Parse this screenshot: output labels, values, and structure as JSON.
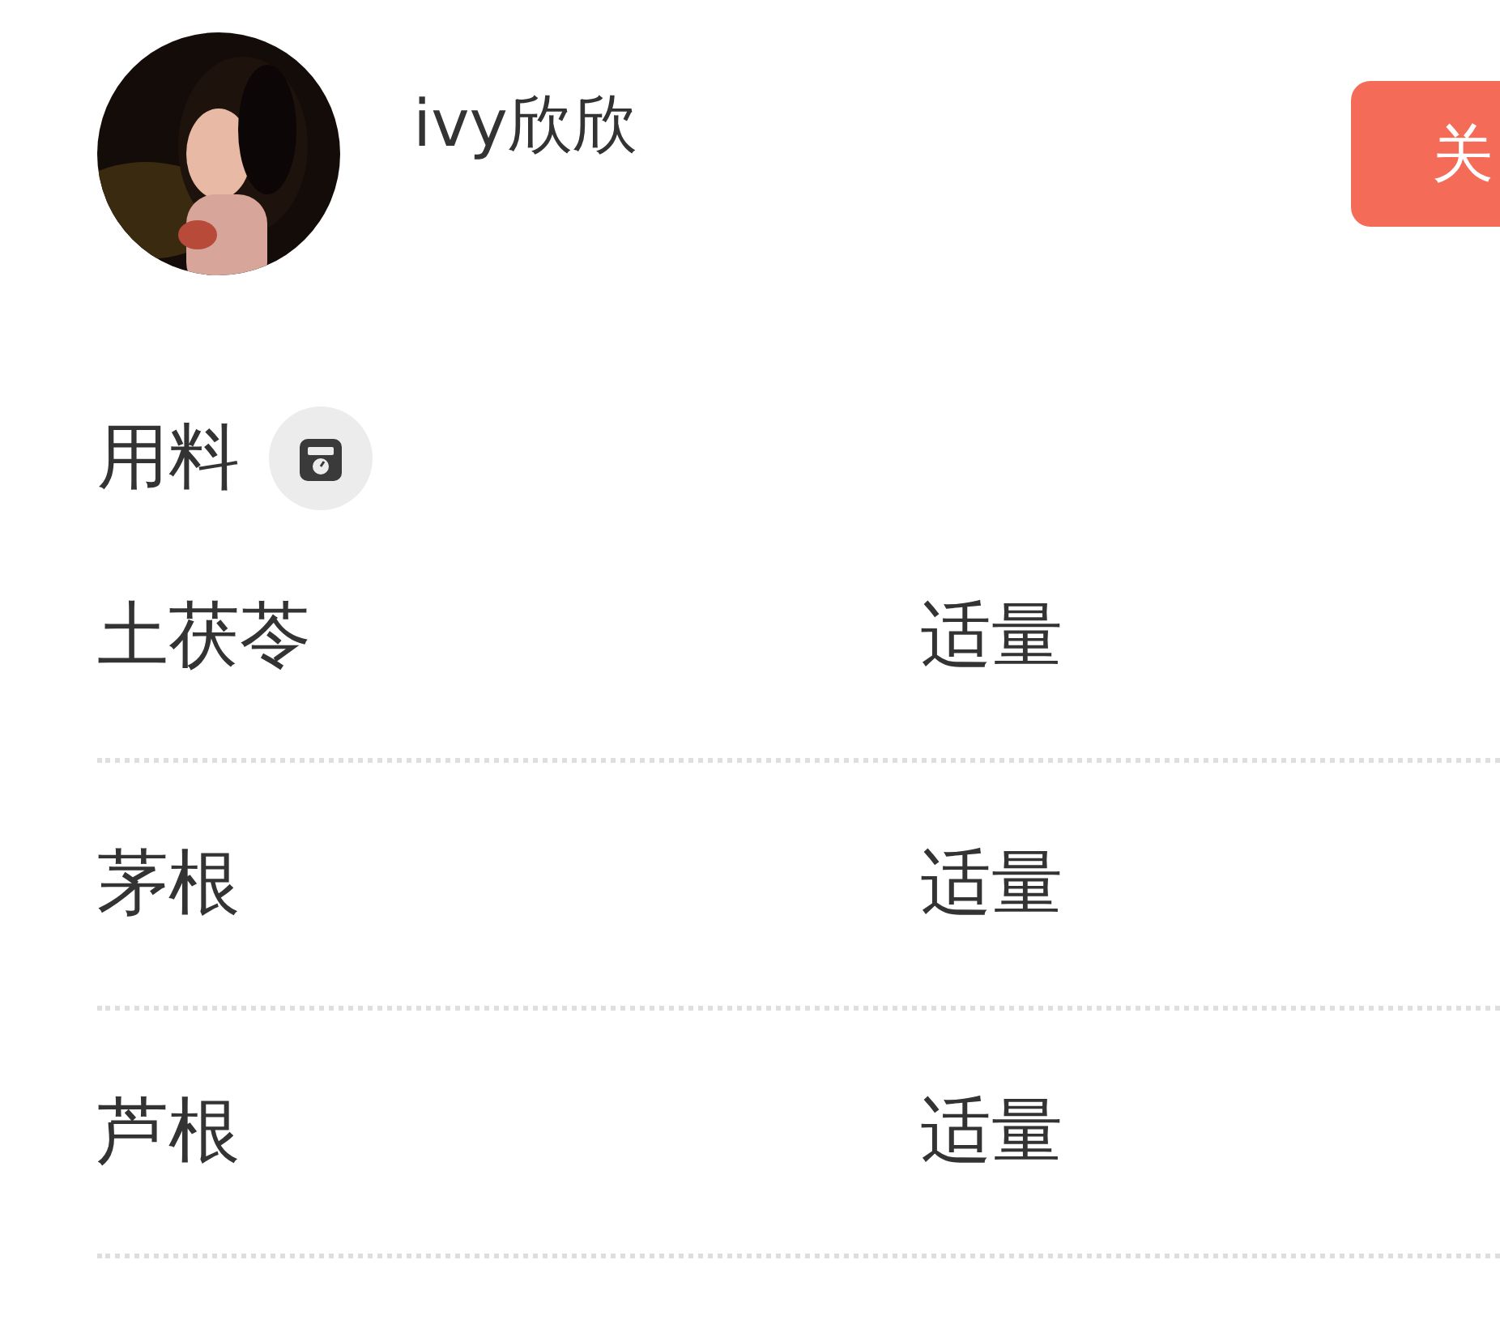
{
  "author": {
    "name": "ivy欣欣",
    "follow_button": "关"
  },
  "ingredients": {
    "title": "用料",
    "items": [
      {
        "name": "土茯苓",
        "amount": "适量"
      },
      {
        "name": "茅根",
        "amount": "适量"
      },
      {
        "name": "芦根",
        "amount": "适量"
      }
    ]
  }
}
